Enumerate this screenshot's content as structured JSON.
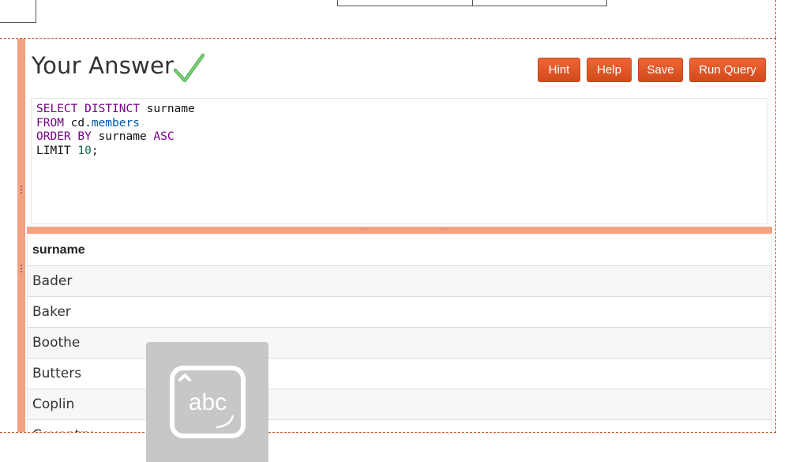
{
  "answer": {
    "title": "Your Answer",
    "buttons": {
      "hint": "Hint",
      "help": "Help",
      "save": "Save",
      "run_query": "Run Query"
    }
  },
  "editor": {
    "lines": [
      [
        "SELECT DISTINCT",
        " surname"
      ],
      [
        "FROM",
        " cd.",
        "members"
      ],
      [
        "ORDER BY",
        " surname ",
        "ASC"
      ],
      [
        "LIMIT ",
        "10",
        ";"
      ]
    ]
  },
  "results": {
    "header": "surname",
    "rows": [
      "Bader",
      "Baker",
      "Boothe",
      "Butters",
      "Coplin",
      "Coventry"
    ]
  },
  "overlay": {
    "icon": "keyboard-abc-icon",
    "label": "abc"
  },
  "colors": {
    "accent": "#e4572e",
    "splitter": "#f4a284",
    "check": "#5cb85c"
  }
}
